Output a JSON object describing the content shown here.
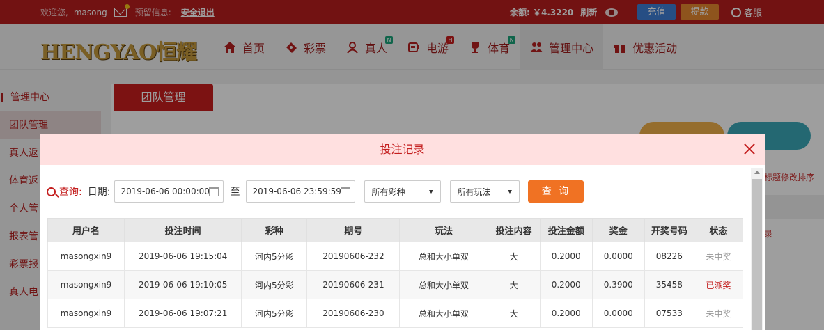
{
  "topbar": {
    "welcome": "欢迎您,",
    "username": "masong",
    "notice_label": "预留信息:",
    "logout": "安全退出",
    "balance": "余额: ￥4.3220",
    "refresh": "刷新",
    "recharge": "充值",
    "withdraw": "提款",
    "service": "客服"
  },
  "logo": "HENGYAO恒耀",
  "nav": [
    {
      "label": "首页",
      "icon": "home-icon"
    },
    {
      "label": "彩票",
      "icon": "ticket-icon"
    },
    {
      "label": "真人",
      "icon": "live-icon",
      "badge": "N"
    },
    {
      "label": "电游",
      "icon": "slot-icon",
      "badge": "H"
    },
    {
      "label": "体育",
      "icon": "trophy-icon",
      "badge": "N"
    },
    {
      "label": "管理中心",
      "icon": "users-icon"
    },
    {
      "label": "优惠活动",
      "icon": "gift-icon"
    }
  ],
  "sidebar": {
    "items": [
      "管理中心",
      "团队管理",
      "真人返",
      "体育返",
      "个人管",
      "报表管",
      "彩票报",
      "真人电"
    ]
  },
  "main": {
    "tab": "团队管理",
    "bg_text1": "标题修改排序",
    "bg_text2": "录"
  },
  "modal": {
    "title": "投注记录",
    "query_label": "查询:",
    "date_label": "日期:",
    "start_date": "2019-06-06 00:00:00",
    "to_label": "至",
    "end_date": "2019-06-06 23:59:59",
    "lottery_select": "所有彩种",
    "play_select": "所有玩法",
    "query_button": "查 询"
  },
  "table": {
    "headers": [
      "用户名",
      "投注时间",
      "彩种",
      "期号",
      "玩法",
      "投注内容",
      "投注金额",
      "奖金",
      "开奖号码",
      "状态"
    ],
    "rows": [
      [
        "masongxin9",
        "2019-06-06 19:15:04",
        "河内5分彩",
        "20190606-232",
        "总和大小单双",
        "大",
        "0.2000",
        "0.0000",
        "08226",
        "未中奖"
      ],
      [
        "masongxin9",
        "2019-06-06 19:10:05",
        "河内5分彩",
        "20190606-231",
        "总和大小单双",
        "大",
        "0.2000",
        "0.3900",
        "35458",
        "已派奖"
      ],
      [
        "masongxin9",
        "2019-06-06 19:07:21",
        "河内5分彩",
        "20190606-230",
        "总和大小单双",
        "大",
        "0.2000",
        "0.0000",
        "07533",
        "未中奖"
      ]
    ]
  }
}
